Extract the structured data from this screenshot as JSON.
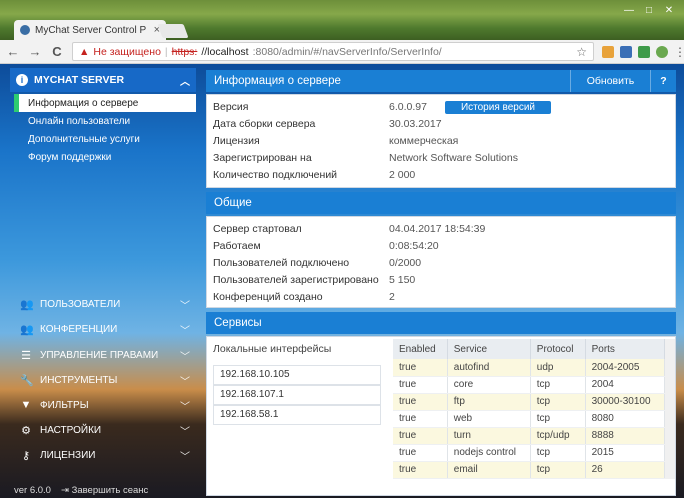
{
  "browser": {
    "tab_title": "MyChat Server Control P",
    "tab_close": "×",
    "url_warning": "Не защищено",
    "url_proto": "https:",
    "url_host": "//localhost",
    "url_path": ":8080/admin/#/navServerInfo/ServerInfo/",
    "back": "←",
    "forward": "→",
    "reload": "C",
    "star": "☆",
    "win_min": "—",
    "win_max": "□",
    "win_close": "✕"
  },
  "sidebar": {
    "header": "MYCHAT SERVER",
    "header_icon": "i",
    "subitems": [
      {
        "label": "Информация о сервере",
        "active": true
      },
      {
        "label": "Онлайн пользователи",
        "active": false
      },
      {
        "label": "Дополнительные услуги",
        "active": false
      },
      {
        "label": "Форум поддержки",
        "active": false
      }
    ],
    "sections": [
      {
        "label": "Пользователи",
        "icon": "users-icon",
        "glyph": "👥"
      },
      {
        "label": "Конференции",
        "icon": "conference-icon",
        "glyph": "👥"
      },
      {
        "label": "Управление правами",
        "icon": "list-icon",
        "glyph": "☰"
      },
      {
        "label": "Инструменты",
        "icon": "wrench-icon",
        "glyph": "🔧"
      },
      {
        "label": "Фильтры",
        "icon": "filter-icon",
        "glyph": "▼"
      },
      {
        "label": "Настройки",
        "icon": "gears-icon",
        "glyph": "⚙"
      },
      {
        "label": "Лицензии",
        "icon": "key-icon",
        "glyph": "⚷"
      }
    ],
    "version": "ver 6.0.0",
    "logout": "Завершить сеанс"
  },
  "server_info": {
    "title": "Информация о сервере",
    "refresh_button": "Обновить",
    "help_button": "?",
    "history_button": "История версий",
    "rows": [
      {
        "key": "Версия",
        "value": "6.0.0.97"
      },
      {
        "key": "Дата сборки сервера",
        "value": "30.03.2017"
      },
      {
        "key": "Лицензия",
        "value": "коммерческая"
      },
      {
        "key": "Зарегистрирован на",
        "value": "Network Software Solutions"
      },
      {
        "key": "Количество подключений",
        "value": "2 000"
      }
    ]
  },
  "general": {
    "title": "Общие",
    "rows": [
      {
        "key": "Сервер стартовал",
        "value": "04.04.2017 18:54:39"
      },
      {
        "key": "Работаем",
        "value": "0:08:54:20"
      },
      {
        "key": "Пользователей подключено",
        "value": "0/2000"
      },
      {
        "key": "Пользователей зарегистрировано",
        "value": "5 150"
      },
      {
        "key": "Конференций создано",
        "value": "2"
      }
    ]
  },
  "services": {
    "title": "Сервисы",
    "interfaces_title": "Локальные интерфейсы",
    "interfaces": [
      "192.168.10.105",
      "192.168.107.1",
      "192.168.58.1"
    ],
    "columns": [
      "Enabled",
      "Service",
      "Protocol",
      "Ports"
    ],
    "rows": [
      [
        "true",
        "autofind",
        "udp",
        "2004-2005"
      ],
      [
        "true",
        "core",
        "tcp",
        "2004"
      ],
      [
        "true",
        "ftp",
        "tcp",
        "30000-30100"
      ],
      [
        "true",
        "web",
        "tcp",
        "8080"
      ],
      [
        "true",
        "turn",
        "tcp/udp",
        "8888"
      ],
      [
        "true",
        "nodejs control",
        "tcp",
        "2015"
      ],
      [
        "true",
        "email",
        "tcp",
        "26"
      ]
    ]
  }
}
